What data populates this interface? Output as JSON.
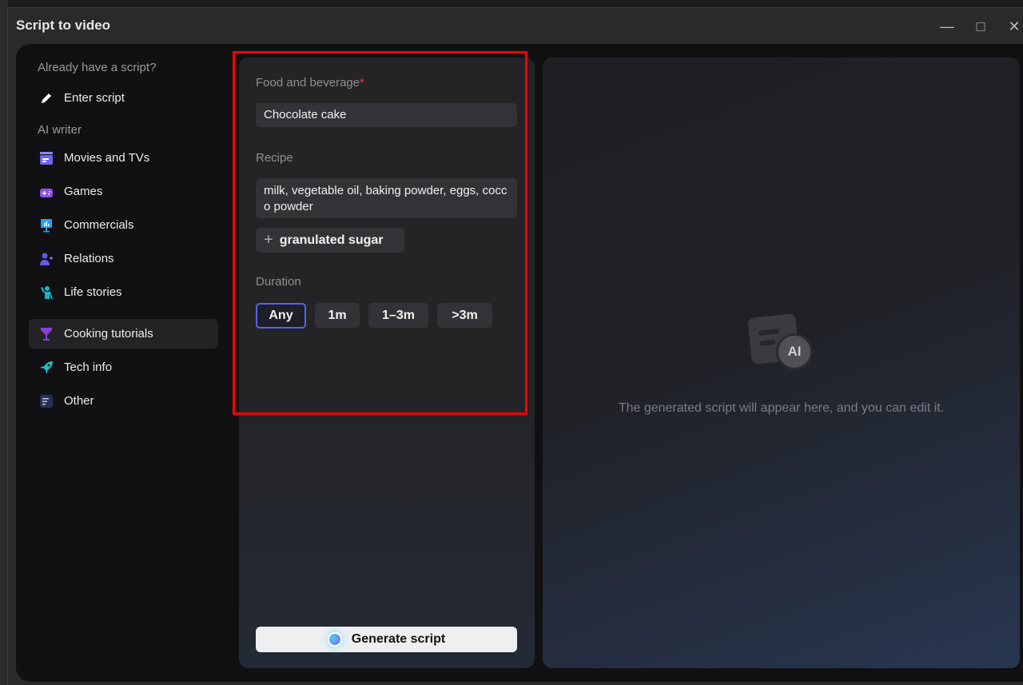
{
  "window": {
    "title": "Script to video",
    "minimize_icon": "minimize-icon",
    "maximize_icon": "maximize-icon",
    "close_icon": "close-icon"
  },
  "sidebar": {
    "section_existing": "Already have a script?",
    "enter_script": "Enter script",
    "section_ai": "AI writer",
    "items": [
      {
        "label": "Movies and TVs",
        "icon": "clapperboard-icon",
        "color": "#6b63f0"
      },
      {
        "label": "Games",
        "icon": "gamepad-icon",
        "color": "#8b4ff0"
      },
      {
        "label": "Commercials",
        "icon": "presentation-chart-icon",
        "color": "#2a9df4"
      },
      {
        "label": "Relations",
        "icon": "people-heart-icon",
        "color": "#5f5ce8"
      },
      {
        "label": "Life stories",
        "icon": "person-waving-icon",
        "color": "#19b6c8"
      },
      {
        "label": "Cooking tutorials",
        "icon": "cocktail-glass-icon",
        "color": "#8a3fd6",
        "active": true
      },
      {
        "label": "Tech info",
        "icon": "rocket-icon",
        "color": "#1fc2c2"
      },
      {
        "label": "Other",
        "icon": "note-edit-icon",
        "color": "#3a3f7a"
      }
    ]
  },
  "form": {
    "food_label": "Food and beverage",
    "required_mark": "*",
    "food_value": "Chocolate cake",
    "recipe_label": "Recipe",
    "recipe_value": "milk, vegetable oil, baking powder, eggs, cocco powder",
    "suggestion": "granulated sugar",
    "duration_label": "Duration",
    "durations": [
      "Any",
      "1m",
      "1–3m",
      ">3m"
    ],
    "selected_duration": "Any",
    "generate_label": "Generate script"
  },
  "preview": {
    "placeholder": "The generated script will appear here, and you can edit it.",
    "icon_text": "AI"
  },
  "colors": {
    "accent": "#5b63e6",
    "highlight": "#ff0000",
    "required": "#e0443f"
  }
}
